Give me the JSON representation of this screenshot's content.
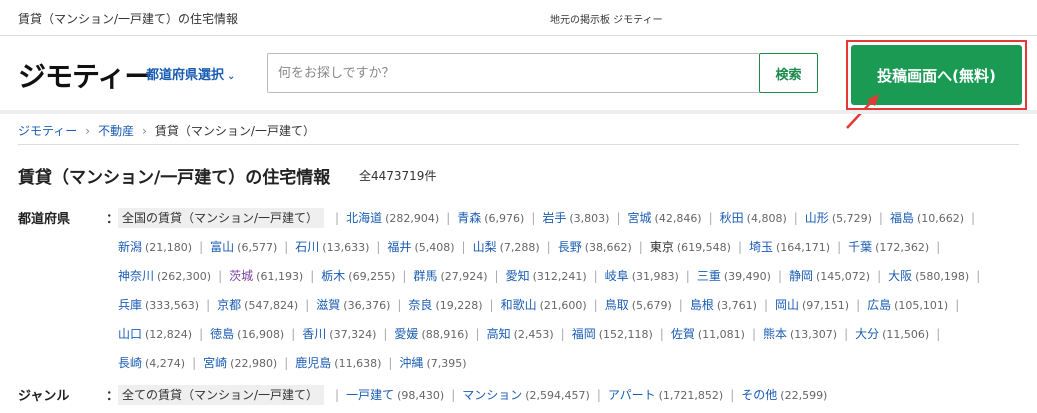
{
  "topbar": {
    "page_heading": "賃貸（マンション/一戸建て）の住宅情報",
    "site_tagline": "地元の掲示板 ジモティー"
  },
  "header": {
    "logo": "ジモティー",
    "pref_select": "都道府県選択",
    "search_placeholder": "何をお探しですか？",
    "search_button": "検索",
    "post_button": "投稿画面へ(無料)"
  },
  "breadcrumb": [
    "ジモティー",
    "不動産",
    "賃貸（マンション/一戸建て）"
  ],
  "main": {
    "title": "賃貸（マンション/一戸建て）の住宅情報",
    "count": "全4473719件"
  },
  "filters": {
    "prefecture": {
      "label": "都道府県",
      "colon": "：",
      "all_label": "全国の賃貸（マンション/一戸建て）",
      "items": [
        {
          "name": "北海道",
          "count": "(282,904)"
        },
        {
          "name": "青森",
          "count": "(6,976)"
        },
        {
          "name": "岩手",
          "count": "(3,803)"
        },
        {
          "name": "宮城",
          "count": "(42,846)"
        },
        {
          "name": "秋田",
          "count": "(4,808)"
        },
        {
          "name": "山形",
          "count": "(5,729)"
        },
        {
          "name": "福島",
          "count": "(10,662)"
        },
        {
          "name": "新潟",
          "count": "(21,180)"
        },
        {
          "name": "富山",
          "count": "(6,577)"
        },
        {
          "name": "石川",
          "count": "(13,633)"
        },
        {
          "name": "福井",
          "count": "(5,408)"
        },
        {
          "name": "山梨",
          "count": "(7,288)"
        },
        {
          "name": "長野",
          "count": "(38,662)"
        },
        {
          "name": "東京",
          "count": "(619,548)"
        },
        {
          "name": "埼玉",
          "count": "(164,171)"
        },
        {
          "name": "千葉",
          "count": "(172,362)"
        },
        {
          "name": "神奈川",
          "count": "(262,300)"
        },
        {
          "name": "茨城",
          "count": "(61,193)"
        },
        {
          "name": "栃木",
          "count": "(69,255)"
        },
        {
          "name": "群馬",
          "count": "(27,924)"
        },
        {
          "name": "愛知",
          "count": "(312,241)"
        },
        {
          "name": "岐阜",
          "count": "(31,983)"
        },
        {
          "name": "三重",
          "count": "(39,490)"
        },
        {
          "name": "静岡",
          "count": "(145,072)"
        },
        {
          "name": "大阪",
          "count": "(580,198)"
        },
        {
          "name": "兵庫",
          "count": "(333,563)"
        },
        {
          "name": "京都",
          "count": "(547,824)"
        },
        {
          "name": "滋賀",
          "count": "(36,376)"
        },
        {
          "name": "奈良",
          "count": "(19,228)"
        },
        {
          "name": "和歌山",
          "count": "(21,600)"
        },
        {
          "name": "鳥取",
          "count": "(5,679)"
        },
        {
          "name": "島根",
          "count": "(3,761)"
        },
        {
          "name": "岡山",
          "count": "(97,151)"
        },
        {
          "name": "広島",
          "count": "(105,101)"
        },
        {
          "name": "山口",
          "count": "(12,824)"
        },
        {
          "name": "徳島",
          "count": "(16,908)"
        },
        {
          "name": "香川",
          "count": "(37,324)"
        },
        {
          "name": "愛媛",
          "count": "(88,916)"
        },
        {
          "name": "高知",
          "count": "(2,453)"
        },
        {
          "name": "福岡",
          "count": "(152,118)"
        },
        {
          "name": "佐賀",
          "count": "(11,081)"
        },
        {
          "name": "熊本",
          "count": "(13,307)"
        },
        {
          "name": "大分",
          "count": "(11,506)"
        },
        {
          "name": "長崎",
          "count": "(4,274)"
        },
        {
          "name": "宮崎",
          "count": "(22,980)"
        },
        {
          "name": "鹿児島",
          "count": "(11,638)"
        },
        {
          "name": "沖縄",
          "count": "(7,395)"
        }
      ]
    },
    "genre": {
      "label": "ジャンル",
      "colon": "：",
      "all_label": "全ての賃貸（マンション/一戸建て）",
      "items": [
        {
          "name": "一戸建て",
          "count": "(98,430)"
        },
        {
          "name": "マンション",
          "count": "(2,594,457)"
        },
        {
          "name": "アパート",
          "count": "(1,721,852)"
        },
        {
          "name": "その他",
          "count": "(22,599)"
        }
      ]
    }
  },
  "colors": {
    "link": "#1a5cb3",
    "accent_green": "#1b9a53",
    "highlight_red": "#e53935"
  }
}
